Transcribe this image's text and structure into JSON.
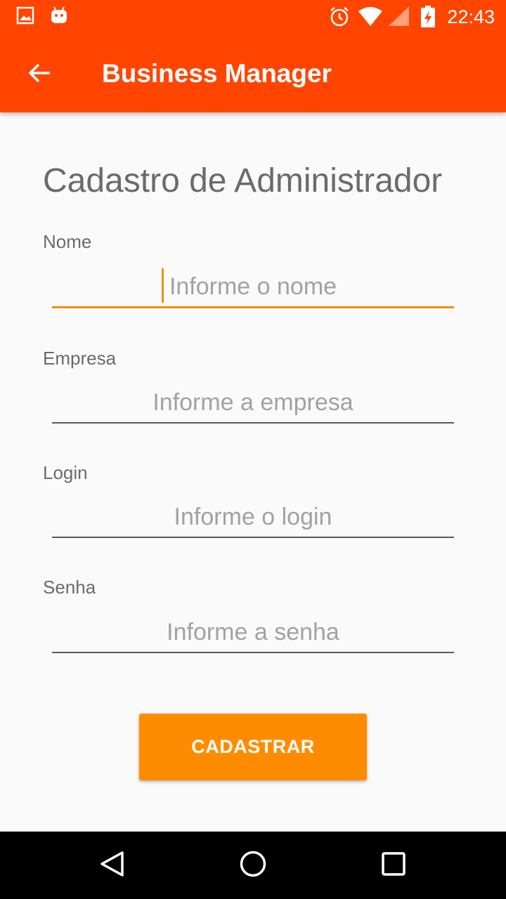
{
  "status_bar": {
    "time": "22:43",
    "icons": [
      "image-notification-icon",
      "android-notification-icon",
      "alarm-icon",
      "wifi-icon",
      "signal-icon",
      "battery-charging-icon"
    ]
  },
  "app_bar": {
    "title": "Business Manager",
    "back_icon": "arrow-back-icon"
  },
  "form": {
    "heading": "Cadastro de Administrador",
    "fields": [
      {
        "label": "Nome",
        "placeholder": "Informe o nome",
        "value": ""
      },
      {
        "label": "Empresa",
        "placeholder": "Informe a empresa",
        "value": ""
      },
      {
        "label": "Login",
        "placeholder": "Informe o login",
        "value": ""
      },
      {
        "label": "Senha",
        "placeholder": "Informe a senha",
        "value": ""
      }
    ],
    "submit_label": "CADASTRAR"
  },
  "nav_bar": {
    "icons": [
      "back-triangle-icon",
      "home-circle-icon",
      "recents-square-icon"
    ]
  },
  "colors": {
    "primary": "#ff4500",
    "accent": "#ff8c00",
    "focus_underline": "#f0900a"
  }
}
